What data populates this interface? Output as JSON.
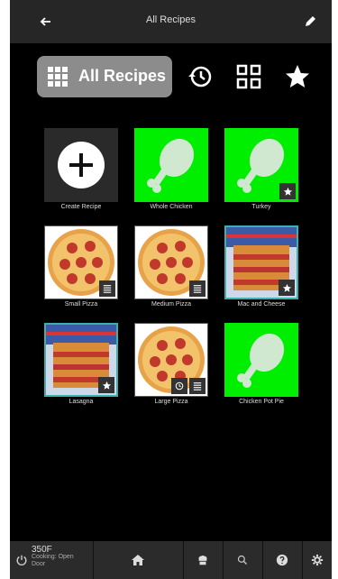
{
  "topbar": {
    "title": "All Recipes"
  },
  "modes": {
    "all_label": "All Recipes"
  },
  "tiles": [
    {
      "label": "Create Recipe"
    },
    {
      "label": "Whole Chicken"
    },
    {
      "label": "Turkey"
    },
    {
      "label": "Small Pizza"
    },
    {
      "label": "Medium Pizza"
    },
    {
      "label": "Mac and Cheese"
    },
    {
      "label": "Lasagna"
    },
    {
      "label": "Large Pizza"
    },
    {
      "label": "Chicken Pot Pie"
    }
  ],
  "bottombar": {
    "temp": "350F",
    "status_line1": "Cooking: Open",
    "status_line2": "Door"
  },
  "colors": {
    "green_tile": "#00ee00",
    "teal_border": "#3ab0b0",
    "bar": "#262626"
  }
}
